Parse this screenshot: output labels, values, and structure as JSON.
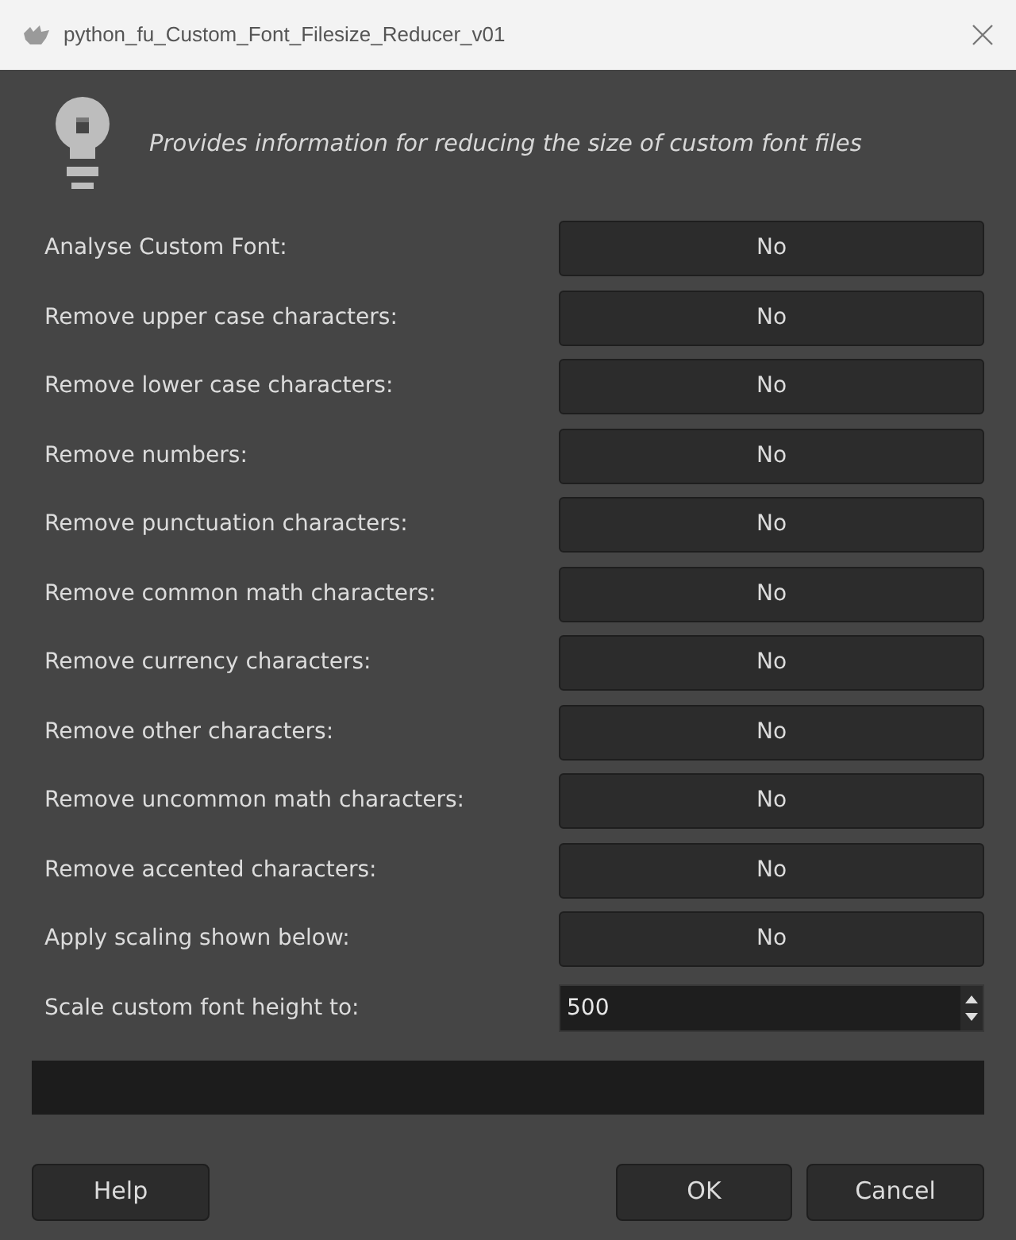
{
  "window": {
    "title": "python_fu_Custom_Font_Filesize_Reducer_v01"
  },
  "description": "Provides information for reducing the size of custom font files",
  "fields": [
    {
      "kind": "toggle",
      "label": "Analyse Custom Font:",
      "value": "No"
    },
    {
      "kind": "toggle",
      "label": "Remove upper case characters:",
      "value": "No"
    },
    {
      "kind": "toggle",
      "label": "Remove lower case characters:",
      "value": "No"
    },
    {
      "kind": "toggle",
      "label": "Remove numbers:",
      "value": "No"
    },
    {
      "kind": "toggle",
      "label": "Remove punctuation characters:",
      "value": "No"
    },
    {
      "kind": "toggle",
      "label": "Remove common math characters:",
      "value": "No"
    },
    {
      "kind": "toggle",
      "label": "Remove currency characters:",
      "value": "No"
    },
    {
      "kind": "toggle",
      "label": "Remove other characters:",
      "value": "No"
    },
    {
      "kind": "toggle",
      "label": "Remove uncommon math characters:",
      "value": "No"
    },
    {
      "kind": "toggle",
      "label": "Remove accented characters:",
      "value": "No"
    },
    {
      "kind": "toggle",
      "label": "Apply scaling shown below:",
      "value": "No"
    },
    {
      "kind": "spin",
      "label": "Scale custom font height to:",
      "value": "500"
    }
  ],
  "progress": {
    "level": 0
  },
  "buttons": {
    "help": "Help",
    "ok": "OK",
    "cancel": "Cancel"
  }
}
